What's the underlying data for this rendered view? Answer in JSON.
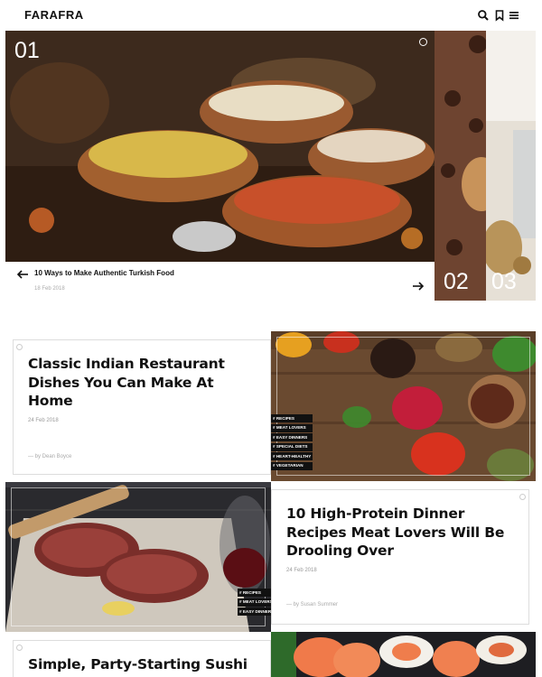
{
  "header": {
    "logo": "FARAFRA",
    "icons": [
      "search-icon",
      "bookmark-icon",
      "menu-icon"
    ]
  },
  "slider": {
    "numbers": [
      "01",
      "02",
      "03"
    ],
    "caption_title": "10 Ways to Make Authentic Turkish Food",
    "caption_date": "18 Feb 2018"
  },
  "cards": [
    {
      "title": "Classic Indian Restaurant Dishes You Can Make At Home",
      "date": "24 Feb 2018",
      "author": "— by Dean Boyce",
      "tags": [
        "# RECIPES",
        "# MEAT LOVERS",
        "# EASY DINNERS",
        "# SPECIAL DIETS",
        "# HEART-HEALTHY",
        "# VEGETARIAN"
      ]
    },
    {
      "title": "10 High-Protein Dinner Recipes Meat Lovers Will Be Drooling Over",
      "date": "24 Feb 2018",
      "author": "— by Susan Summer",
      "tags": [
        "# RECIPES",
        "# MEAT LOVERS",
        "# EASY DINNERS"
      ]
    },
    {
      "title": "Simple, Party-Starting Sushi Rolls"
    }
  ],
  "colors": {
    "text": "#111111",
    "muted": "#999999",
    "tag_bg": "#111111"
  }
}
